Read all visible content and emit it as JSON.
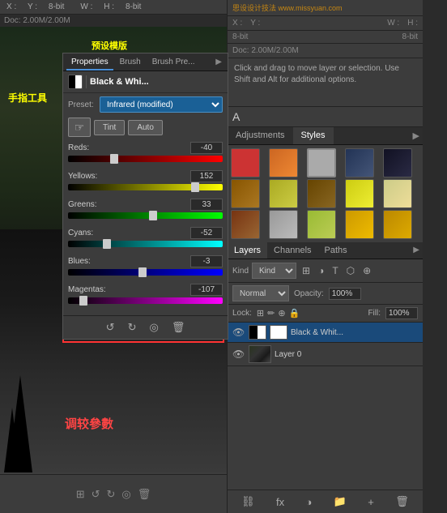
{
  "watermark": "思设设计技法 www.missyuan.com",
  "annotation": {
    "hand_tool": "手指工具",
    "preset_label": "预设模版",
    "params_label": "调较參數"
  },
  "properties_panel": {
    "tabs": [
      "Properties",
      "Brush",
      "Brush Pre..."
    ],
    "title": "Black & Whi...",
    "preset_label": "Preset:",
    "preset_value": "Infrared (modified)",
    "tint_label": "Tint",
    "auto_label": "Auto",
    "sliders": [
      {
        "label": "Reds:",
        "value": "-40",
        "percent": 30,
        "type": "reds"
      },
      {
        "label": "Yellows:",
        "value": "152",
        "percent": 82,
        "type": "yellows"
      },
      {
        "label": "Greens:",
        "value": "33",
        "percent": 55,
        "type": "greens"
      },
      {
        "label": "Cyans:",
        "value": "-52",
        "percent": 25,
        "type": "cyans"
      },
      {
        "label": "Blues:",
        "value": "-3",
        "percent": 48,
        "type": "blues"
      },
      {
        "label": "Magentas:",
        "value": "-107",
        "percent": 10,
        "type": "magentas"
      }
    ],
    "bottom_tools": [
      "↺",
      "↻",
      "◎",
      "🗑"
    ]
  },
  "help_text": {
    "doc_info": "Doc: 2.00M/2.00M",
    "description": "Click and drag to move layer or selection. Use Shift and Alt for additional options.",
    "coord_x": "X :",
    "coord_y": "Y :",
    "width": "W :",
    "height": "H :",
    "bit_depth_left": "8-bit",
    "bit_depth_right": "8-bit"
  },
  "adjustments_panel": {
    "tabs": [
      "Adjustments",
      "Styles"
    ],
    "active_tab": "Styles"
  },
  "styles": [
    {
      "color": "#cc3333",
      "style": "red-x"
    },
    {
      "color": "#cc6622",
      "style": "orange"
    },
    {
      "color": "#888888",
      "style": "gray-border"
    },
    {
      "color": "#555577",
      "style": "dark-blue"
    },
    {
      "color": "#1a1a2a",
      "style": "very-dark"
    },
    {
      "color": "#aa7722",
      "style": "gold"
    },
    {
      "color": "#ccaa33",
      "style": "yellow-gold"
    },
    {
      "color": "#886600",
      "style": "dark-gold"
    },
    {
      "color": "#ddcc44",
      "style": "bright-gold"
    },
    {
      "color": "#ddcc88",
      "style": "light-gold"
    },
    {
      "color": "#884422",
      "style": "brown-red"
    },
    {
      "color": "#aaaaaa",
      "style": "light-gray"
    },
    {
      "color": "#bbcc55",
      "style": "green-yellow"
    },
    {
      "color": "#ddcc11",
      "style": "bright-yellow"
    },
    {
      "color": "#cc9900",
      "style": "amber"
    }
  ],
  "layers_panel": {
    "tabs": [
      "Layers",
      "Channels",
      "Paths"
    ],
    "active_tab": "Layers",
    "kind_label": "Kind",
    "blend_mode": "Normal",
    "opacity_label": "Opacity:",
    "opacity_value": "100%",
    "lock_label": "Lock:",
    "fill_label": "Fill:",
    "fill_value": "100%",
    "layers": [
      {
        "name": "Black & Whit...",
        "type": "adjustment",
        "visible": true
      },
      {
        "name": "Layer 0",
        "type": "photo",
        "visible": true
      }
    ],
    "bottom_buttons": [
      "⛓",
      "fx",
      "◑",
      "📁",
      "🗑"
    ]
  }
}
